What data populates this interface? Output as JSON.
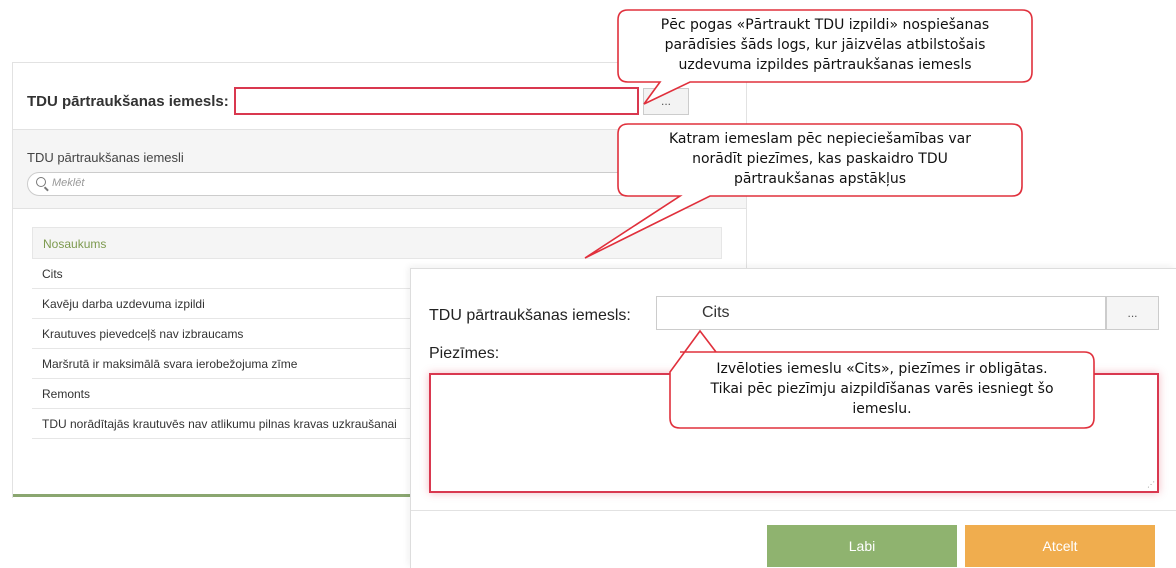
{
  "back_panel": {
    "reason_label": "TDU pārtraukšanas iemesls:",
    "dots_label": "...",
    "list_title": "TDU pārtraukšanas iemesli",
    "search_placeholder": "Meklēt",
    "table_header": "Nosaukums",
    "rows": [
      "Cits",
      "Kavēju darba uzdevuma izpildi",
      "Krautuves pievedceļš nav izbraucams",
      "Maršrutā ir maksimālā svara ierobežojuma zīme",
      "Remonts",
      "TDU norādītajās krautuvēs nav atlikumu pilnas kravas uzkraušanai"
    ]
  },
  "front_dialog": {
    "reason_label": "TDU pārtraukšanas iemesls:",
    "reason_value": "Cits",
    "dots_label": "...",
    "notes_label": "Piezīmes:",
    "ok_label": "Labi",
    "cancel_label": "Atcelt"
  },
  "callouts": {
    "top": [
      "Pēc pogas «Pārtraukt TDU izpildi» nospiešanas",
      "parādīsies šāds logs, kur jāizvēlas atbilstošais",
      "uzdevuma izpildes pārtraukšanas iemesls"
    ],
    "middle": [
      "Katram iemeslam pēc nepieciešamības var",
      "norādīt piezīmes, kas paskaidro TDU",
      "pārtraukšanas apstākļus"
    ],
    "bottom": [
      "Izvēloties iemeslu «Cits», piezīmes ir obligātas.",
      "Tikai pēc piezīmju aizpildīšanas varēs iesniegt šo",
      "iemeslu."
    ]
  },
  "colors": {
    "accent_red": "#d9384f",
    "ok_green": "#8fb36f",
    "cancel_orange": "#f0ad4e",
    "header_green": "#7d9a4f"
  }
}
